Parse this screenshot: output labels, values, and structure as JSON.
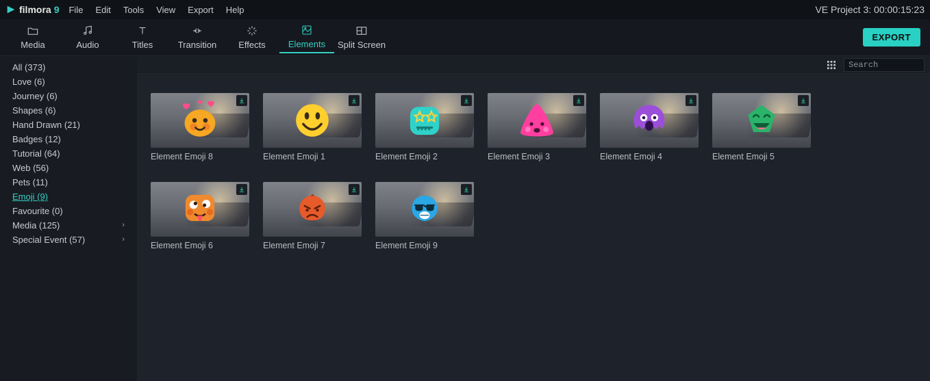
{
  "app": {
    "name": "filmora",
    "version": "9"
  },
  "menus": [
    "File",
    "Edit",
    "Tools",
    "View",
    "Export",
    "Help"
  ],
  "project": {
    "label": "VE Project 3:",
    "timecode": "00:00:15:23"
  },
  "tabs": [
    {
      "id": "media",
      "label": "Media"
    },
    {
      "id": "audio",
      "label": "Audio"
    },
    {
      "id": "titles",
      "label": "Titles"
    },
    {
      "id": "transition",
      "label": "Transition"
    },
    {
      "id": "effects",
      "label": "Effects"
    },
    {
      "id": "elements",
      "label": "Elements",
      "active": true
    },
    {
      "id": "splitscreen",
      "label": "Split Screen"
    }
  ],
  "export_label": "EXPORT",
  "sidebar": {
    "items": [
      {
        "label": "All (373)"
      },
      {
        "label": "Love (6)"
      },
      {
        "label": "Journey (6)"
      },
      {
        "label": "Shapes (6)"
      },
      {
        "label": "Hand Drawn (21)"
      },
      {
        "label": "Badges (12)"
      },
      {
        "label": "Tutorial (64)"
      },
      {
        "label": "Web (56)"
      },
      {
        "label": "Pets (11)"
      },
      {
        "label": "Emoji (9)",
        "selected": true
      },
      {
        "label": "Favourite (0)"
      },
      {
        "label": "Media (125)",
        "expandable": true
      },
      {
        "label": "Special Event (57)",
        "expandable": true
      }
    ]
  },
  "search": {
    "placeholder": "Search"
  },
  "elements": [
    {
      "label": "Element Emoji 8",
      "emoji": "love-orange"
    },
    {
      "label": "Element Emoji 1",
      "emoji": "smile-yellow"
    },
    {
      "label": "Element Emoji 2",
      "emoji": "star-eyes-teal"
    },
    {
      "label": "Element Emoji 3",
      "emoji": "triangle-pink"
    },
    {
      "label": "Element Emoji 4",
      "emoji": "scream-purple"
    },
    {
      "label": "Element Emoji 5",
      "emoji": "laugh-green"
    },
    {
      "label": "Element Emoji 6",
      "emoji": "tongue-orange"
    },
    {
      "label": "Element Emoji 7",
      "emoji": "angry-redorange"
    },
    {
      "label": "Element Emoji 9",
      "emoji": "cool-blue"
    }
  ]
}
